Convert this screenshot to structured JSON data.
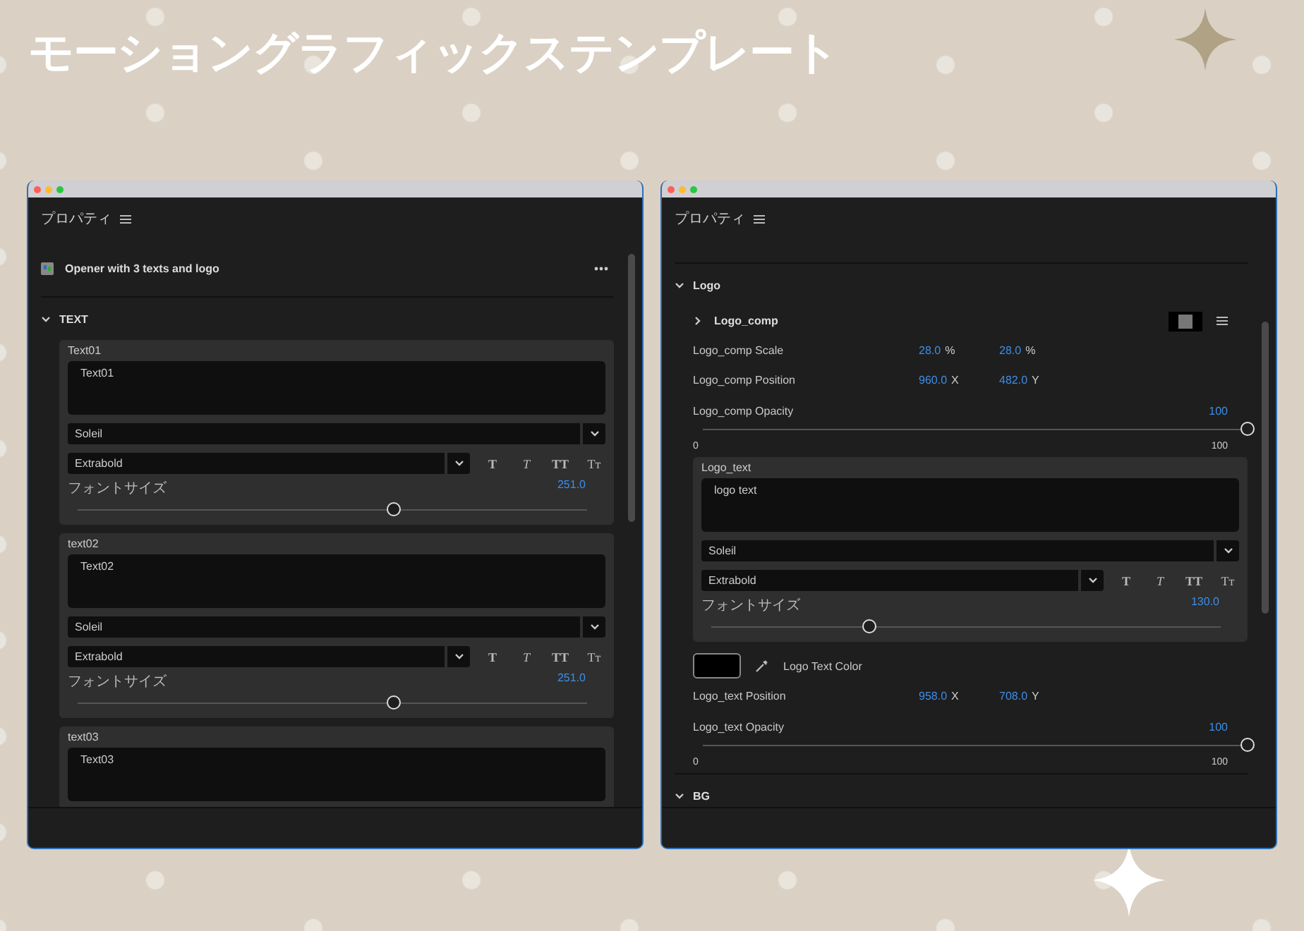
{
  "title": "モーショングラフィックステンプレート",
  "panels": [
    {
      "title": "プロパティ",
      "template": {
        "name": "Opener with 3 texts and logo"
      },
      "sections": [
        {
          "label": "TEXT",
          "expanded": true,
          "items": [
            {
              "kind": "text_card",
              "label": "Text01",
              "value": "Text01",
              "font": "Soleil",
              "style": "Extrabold",
              "style_buttons": [
                {
                  "kind": "bold",
                  "label": "T"
                },
                {
                  "kind": "italic",
                  "label": "T"
                },
                {
                  "kind": "caps",
                  "label": "TT"
                },
                {
                  "kind": "smallcaps",
                  "label": "Tᴛ"
                }
              ],
              "size_label": "フォントサイズ",
              "size_value": "251.0",
              "level": 0.62
            },
            {
              "kind": "text_card",
              "label": "text02",
              "value": "Text02",
              "font": "Soleil",
              "style": "Extrabold",
              "style_buttons": [
                {
                  "kind": "bold",
                  "label": "T"
                },
                {
                  "kind": "italic",
                  "label": "T"
                },
                {
                  "kind": "caps",
                  "label": "TT"
                },
                {
                  "kind": "smallcaps",
                  "label": "Tᴛ"
                }
              ],
              "size_label": "フォントサイズ",
              "size_value": "251.0",
              "level": 0.62
            },
            {
              "kind": "text_card",
              "label": "text03",
              "value": "Text03"
            }
          ]
        }
      ]
    },
    {
      "title": "プロパティ",
      "sections": [
        {
          "label": "Logo",
          "expanded": true,
          "items": [
            {
              "kind": "comp",
              "label": "Logo_comp",
              "expanded": false
            },
            {
              "kind": "pair",
              "label": "Logo_comp Scale",
              "values": [
                {
                  "value": "28.0",
                  "unit": "%"
                },
                {
                  "value": "28.0",
                  "unit": "%"
                }
              ]
            },
            {
              "kind": "pair",
              "label": "Logo_comp Position",
              "values": [
                {
                  "value": "960.0",
                  "unit": "X"
                },
                {
                  "value": "482.0",
                  "unit": "Y"
                }
              ]
            },
            {
              "kind": "slider",
              "label": "Logo_comp Opacity",
              "value": "100",
              "level": 1,
              "min": "0",
              "max": "100"
            },
            {
              "kind": "text_card",
              "label": "Logo_text",
              "value": "logo text",
              "font": "Soleil",
              "style": "Extrabold",
              "style_buttons": [
                {
                  "kind": "bold",
                  "label": "T"
                },
                {
                  "kind": "italic",
                  "label": "T"
                },
                {
                  "kind": "caps",
                  "label": "TT"
                },
                {
                  "kind": "smallcaps",
                  "label": "Tᴛ"
                }
              ],
              "size_label": "フォントサイズ",
              "size_value": "130.0",
              "level": 0.31
            },
            {
              "kind": "color",
              "label": "Logo Text Color",
              "color": "#000000"
            },
            {
              "kind": "pair",
              "label": "Logo_text Position",
              "values": [
                {
                  "value": "958.0",
                  "unit": "X"
                },
                {
                  "value": "708.0",
                  "unit": "Y"
                }
              ]
            },
            {
              "kind": "slider",
              "label": "Logo_text Opacity",
              "value": "100",
              "level": 1,
              "min": "0",
              "max": "100"
            }
          ]
        },
        {
          "label": "BG",
          "expanded": true
        }
      ]
    }
  ]
}
